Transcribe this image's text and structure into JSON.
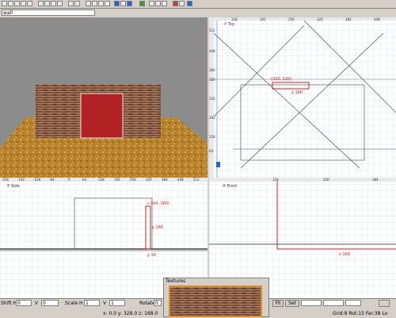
{
  "toolbar": {
    "icons": [
      "select-icon",
      "rotate-icon",
      "undo-icon",
      "flip-icon",
      "scale-icon",
      "clip-icon",
      "vertex-icon",
      "brush-icon",
      "entity-icon",
      "face-icon",
      "texture-icon",
      "camera-icon",
      "grid-icon",
      "view-icon",
      "settings-icon"
    ]
  },
  "texture": {
    "name": "wall"
  },
  "views": {
    "topright": {
      "label": "-Y Top",
      "marker_label": "(320, 320)",
      "dim_label": "y 160",
      "ruler_x": [
        "128",
        "192",
        "256",
        "320",
        "384",
        "448"
      ],
      "ruler_y": [
        "512",
        "448",
        "384",
        "320",
        "256",
        "192",
        "128",
        "64"
      ]
    },
    "bottomleft": {
      "label": "-Y Side",
      "dim_top": "(-304, 160)",
      "dim_mid": "y 160",
      "dim_bot": "y 16",
      "ruler_x": [
        "-256",
        "-192",
        "-128",
        "-64",
        "0",
        "64",
        "128",
        "192",
        "256",
        "320",
        "384",
        "448",
        "512"
      ]
    },
    "bottomright": {
      "label": "-X Front",
      "dim_bot": "x 160",
      "ruler_x": [
        "128",
        "256",
        "384"
      ]
    }
  },
  "bottom": {
    "shift_h_label": "Shift H",
    "shift_h": "0",
    "shift_v_label": "V",
    "shift_v": "0",
    "scale_h_label": "Scale H",
    "scale_h": "1",
    "scale_v_label": "V",
    "scale_v": "1",
    "rotate_label": "Rotate",
    "rotate": "0",
    "fit_label": "Fit",
    "set_label": "Set",
    "textures_title": "Textures",
    "coords": "x: 0.0  y: 328.0  z: 168.0",
    "grid_info": "Grid:8 Rot:15 Far:38 Lo"
  },
  "colors": {
    "view_bg": "#ffffff",
    "grid": "#c8d4e0",
    "accent_red": "#d02020",
    "brick": "#7a4a34",
    "door": "#b22222",
    "ground": "#b8832e",
    "sky": "#8c8c8c"
  }
}
